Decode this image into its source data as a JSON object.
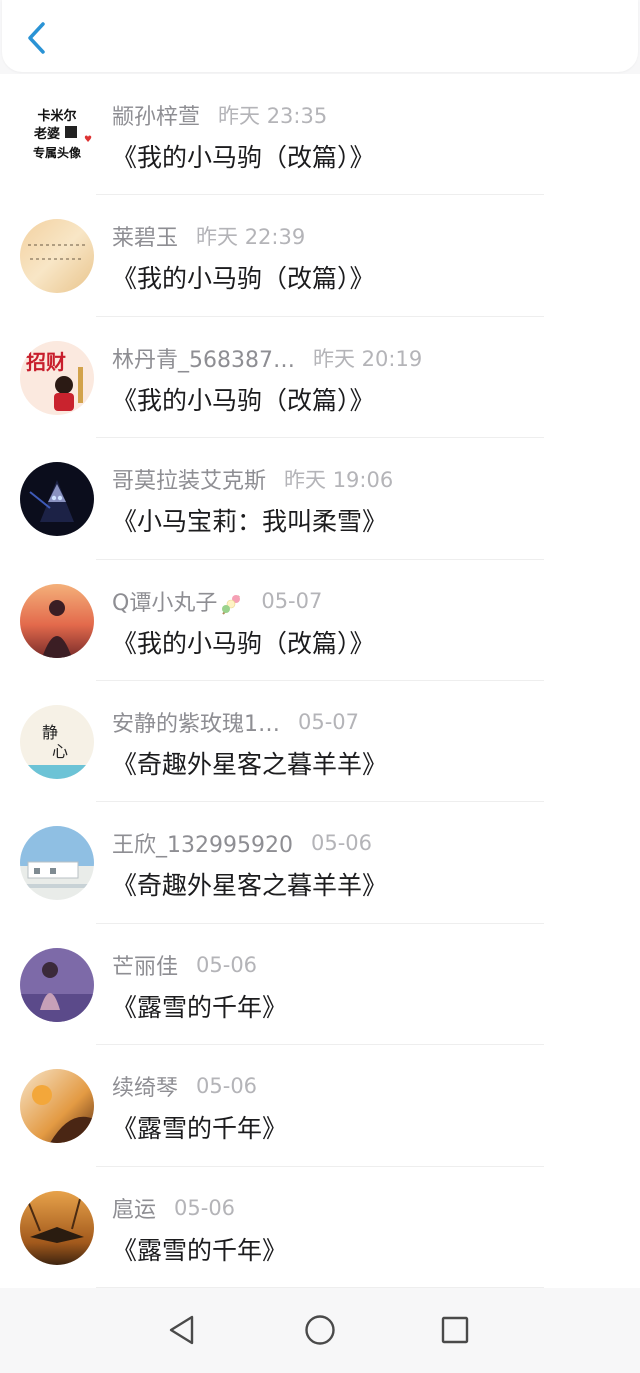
{
  "header": {
    "back_icon": "chevron-left-icon",
    "accent_color": "#2a93d5"
  },
  "items": [
    {
      "name": "颛孙梓萱",
      "date": "昨天 23:35",
      "title": "《我的小马驹（改篇）》",
      "avatar_text": "卡米尔老婆专属头像"
    },
    {
      "name": "莱碧玉",
      "date": "昨天 22:39",
      "title": "《我的小马驹（改篇）》",
      "avatar_text": ""
    },
    {
      "name": "林丹青_568387…",
      "date": "昨天 20:19",
      "title": "《我的小马驹（改篇）》",
      "avatar_text": "招财"
    },
    {
      "name": "哥莫拉装艾克斯",
      "date": "昨天 19:06",
      "title": "《小马宝莉：我叫柔雪》",
      "avatar_text": ""
    },
    {
      "name": "Q谭小丸子",
      "date": "05-07",
      "title": "《我的小马驹（改篇）》",
      "avatar_text": ""
    },
    {
      "name": "安静的紫玫瑰1…",
      "date": "05-07",
      "title": "《奇趣外星客之暮羊羊》",
      "avatar_text": "静心"
    },
    {
      "name": "王欣_132995920",
      "date": "05-06",
      "title": "《奇趣外星客之暮羊羊》",
      "avatar_text": ""
    },
    {
      "name": "芒丽佳",
      "date": "05-06",
      "title": "《露雪的千年》",
      "avatar_text": ""
    },
    {
      "name": "续绮琴",
      "date": "05-06",
      "title": "《露雪的千年》",
      "avatar_text": ""
    },
    {
      "name": "扈运",
      "date": "05-06",
      "title": "《露雪的千年》",
      "avatar_text": ""
    }
  ],
  "navbar": {
    "back_icon": "triangle-back-icon",
    "home_icon": "circle-home-icon",
    "recents_icon": "square-recents-icon"
  }
}
